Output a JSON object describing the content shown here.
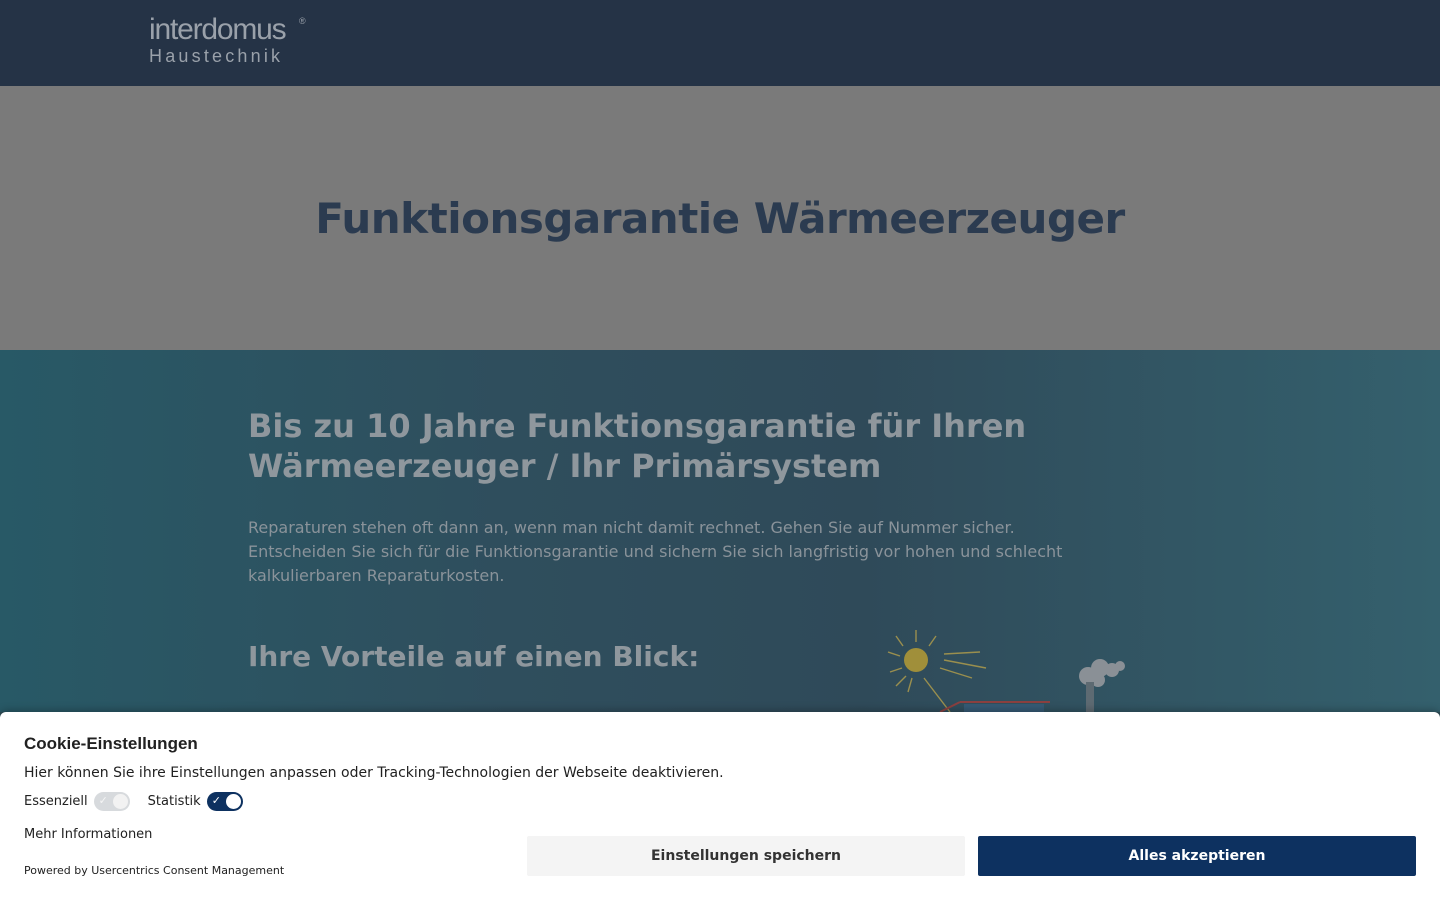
{
  "header": {
    "logo_main": "interdomus",
    "logo_reg": "®",
    "logo_sub": "Haustechnik"
  },
  "hero": {
    "title": "Funktionsgarantie Wärmeerzeuger"
  },
  "content": {
    "heading": "Bis zu 10 Jahre Funktionsgarantie für Ihren Wärmeerzeuger / Ihr Primärsystem",
    "lead": "Reparaturen stehen oft dann an, wenn man nicht damit rechnet. Gehen Sie auf Nummer sicher. Entscheiden Sie sich für die Funktionsgarantie und sichern Sie sich langfristig vor hohen und schlecht kalkulierbaren Reparaturkosten.",
    "subheading": "Ihre Vorteile auf einen Blick:"
  },
  "cookie": {
    "title": "Cookie-Einstellungen",
    "description": "Hier können Sie ihre Einstellungen anpassen oder Tracking-Technologien der Webseite deaktivieren.",
    "toggles": [
      {
        "label": "Essenziell",
        "checked": true,
        "disabled": true
      },
      {
        "label": "Statistik",
        "checked": true,
        "disabled": false
      }
    ],
    "more_info": "Mehr Informationen",
    "powered_by": "Powered by Usercentrics Consent Management",
    "save_button": "Einstellungen speichern",
    "accept_button": "Alles akzeptieren"
  },
  "colors": {
    "header_bg": "#253346",
    "hero_bg": "#7a7a7a",
    "accent": "#0d3160",
    "title_color": "#2b3b50"
  }
}
